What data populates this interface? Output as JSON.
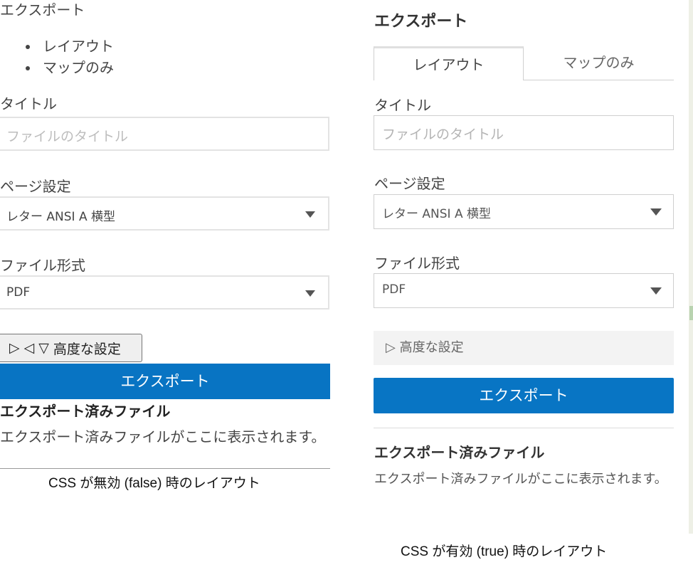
{
  "left_panel": {
    "title": "エクスポート",
    "list": [
      "レイアウト",
      "マップのみ"
    ],
    "title_label": "タイトル",
    "title_placeholder": "ファイルのタイトル",
    "page_label": "ページ設定",
    "page_value": "レター ANSI A 横型",
    "format_label": "ファイル形式",
    "format_value": "PDF",
    "advanced_markers": "▷ ◁ ▽",
    "advanced_label": "高度な設定",
    "export_button": "エクスポート",
    "files_heading": "エクスポート済みファイル",
    "files_text": "エクスポート済みファイルがここに表示されます。",
    "caption": "CSS が無効 (false) 時のレイアウト"
  },
  "right_panel": {
    "title": "エクスポート",
    "tabs": [
      {
        "label": "レイアウト",
        "active": true
      },
      {
        "label": "マップのみ",
        "active": false
      }
    ],
    "title_label": "タイトル",
    "title_placeholder": "ファイルのタイトル",
    "page_label": "ページ設定",
    "page_value": "レター ANSI A 横型",
    "format_label": "ファイル形式",
    "format_value": "PDF",
    "advanced_marker": "▷",
    "advanced_label": "高度な設定",
    "export_button": "エクスポート",
    "files_heading": "エクスポート済みファイル",
    "files_text": "エクスポート済みファイルがここに表示されます。",
    "caption": "CSS が有効 (true) 時のレイアウト"
  },
  "colors": {
    "export_button": "#0874c3",
    "advanced_bg": "#f3f3f3"
  }
}
